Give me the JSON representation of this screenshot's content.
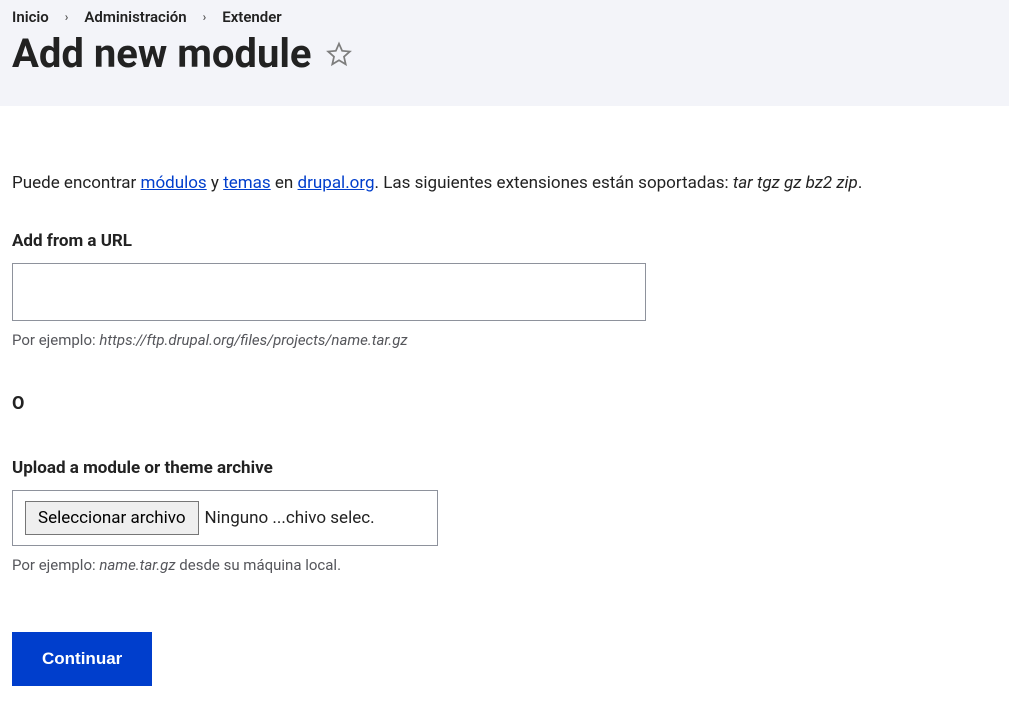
{
  "breadcrumb": {
    "item0": "Inicio",
    "item1": "Administración",
    "item2": "Extender"
  },
  "page_title": "Add new module",
  "intro": {
    "prefix": "Puede encontrar ",
    "link_modules": "módulos",
    "and": " y ",
    "link_themes": "temas",
    "mid": " en ",
    "link_drupal": "drupal.org",
    "suffix": ". Las siguientes extensiones están soportadas: ",
    "extensions": "tar tgz gz bz2 zip",
    "period": "."
  },
  "url_field": {
    "label": "Add from a URL",
    "help_prefix": "Por ejemplo: ",
    "help_example": "https://ftp.drupal.org/files/projects/name.tar.gz"
  },
  "or_label": "O",
  "upload_field": {
    "label": "Upload a module or theme archive",
    "button_label": "Seleccionar archivo",
    "status_text": "Ninguno ...chivo selec.",
    "help_prefix": "Por ejemplo: ",
    "help_example": "name.tar.gz",
    "help_suffix": " desde su máquina local."
  },
  "submit_label": "Continuar"
}
